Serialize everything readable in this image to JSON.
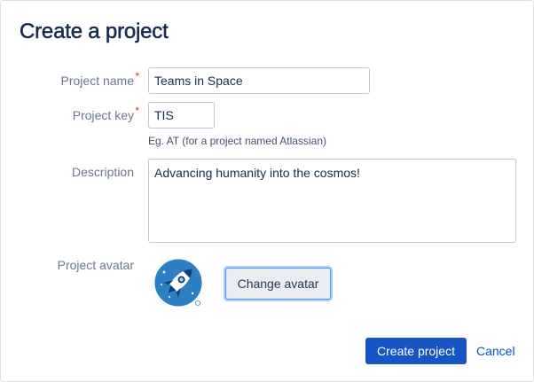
{
  "dialog": {
    "title": "Create a project"
  },
  "form": {
    "project_name": {
      "label": "Project name",
      "required_mark": "*",
      "value": "Teams in Space"
    },
    "project_key": {
      "label": "Project key",
      "required_mark": "*",
      "value": "TIS",
      "hint": "Eg. AT (for a project named Atlassian)"
    },
    "description": {
      "label": "Description",
      "value": "Advancing humanity into the cosmos!"
    },
    "avatar": {
      "label": "Project avatar",
      "icon": "rocket-avatar-icon",
      "change_label": "Change avatar"
    }
  },
  "actions": {
    "create_label": "Create project",
    "cancel_label": "Cancel"
  },
  "colors": {
    "primary": "#1754c4",
    "link": "#0052cc",
    "required": "#de350b",
    "label": "#6b778c",
    "title": "#172b4d",
    "focus_ring": "#4c9aff"
  }
}
